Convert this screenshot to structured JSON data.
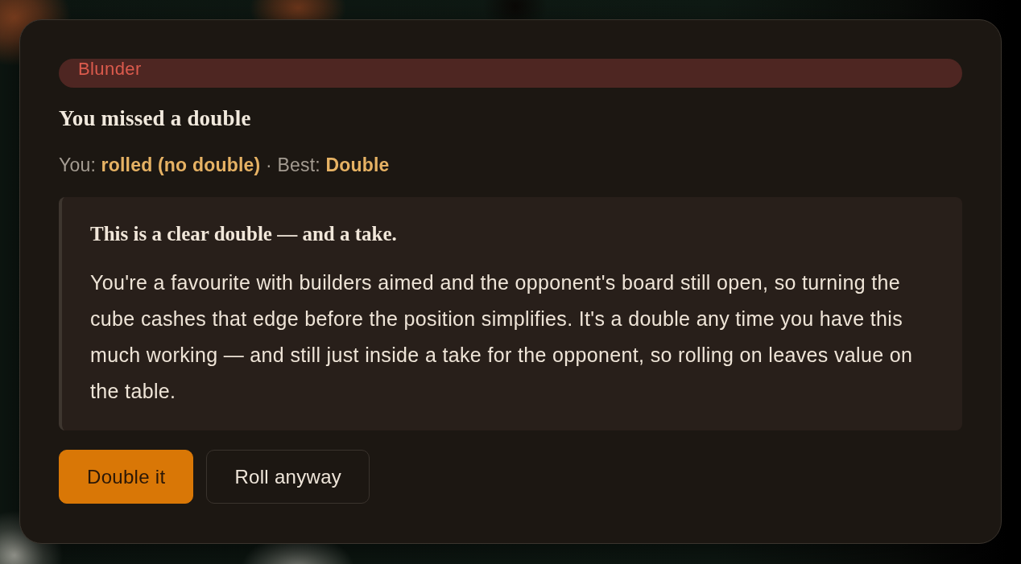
{
  "card": {
    "badge": "Blunder",
    "title": "You missed a double",
    "summary": "You: **rolled (no double)** · Best: **Double**",
    "explanation": {
      "heading": "This is a clear double — and a take.",
      "body": "You're a favourite with builders aimed and the opponent's board still open, so turning the cube cashes that edge before the position simplifies. It's a double any time you have this much working — and still just inside a take for the opponent, so rolling on leaves value on the table."
    },
    "buttons": [
      {
        "label": "Double it",
        "kind": "primary"
      },
      {
        "label": "Roll anyway",
        "kind": "secondary"
      }
    ]
  }
}
